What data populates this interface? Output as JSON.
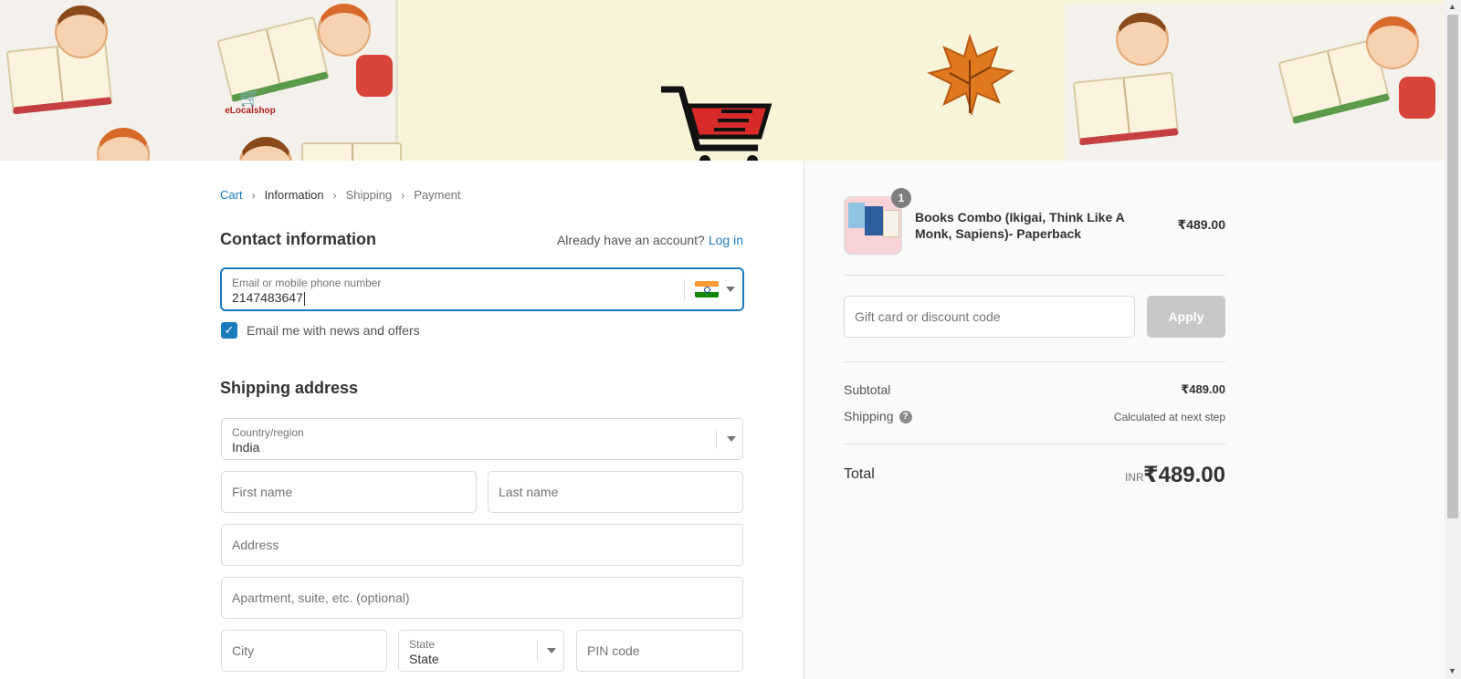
{
  "banner": {
    "logo_text": "eLocalshop"
  },
  "breadcrumb": {
    "items": [
      {
        "label": "Cart"
      },
      {
        "label": "Information"
      },
      {
        "label": "Shipping"
      },
      {
        "label": "Payment"
      }
    ]
  },
  "contact": {
    "title": "Contact information",
    "account_prompt": "Already have an account?",
    "login_label": "Log in",
    "email_label": "Email or mobile phone number",
    "email_value": "2147483647",
    "newsletter_label": "Email me with news and offers",
    "newsletter_checked": true
  },
  "shipping": {
    "title": "Shipping address",
    "country_label": "Country/region",
    "country_value": "India",
    "first_name_placeholder": "First name",
    "last_name_placeholder": "Last name",
    "address_placeholder": "Address",
    "apartment_placeholder": "Apartment, suite, etc. (optional)",
    "city_placeholder": "City",
    "state_label": "State",
    "state_value": "State",
    "pin_placeholder": "PIN code"
  },
  "summary": {
    "product_name": "Books Combo (Ikigai, Think Like A Monk, Sapiens)- Paperback",
    "product_price": "₹489.00",
    "quantity": "1",
    "discount_placeholder": "Gift card or discount code",
    "apply_label": "Apply",
    "subtotal_label": "Subtotal",
    "subtotal_value": "₹489.00",
    "shipping_label": "Shipping",
    "shipping_value": "Calculated at next step",
    "help_glyph": "?",
    "total_label": "Total",
    "total_currency": "INR",
    "total_value": "₹489.00"
  },
  "colors": {
    "link": "#197bbd",
    "checkbox": "#197bbd",
    "apply_disabled": "#c8c8c8",
    "summary_bg": "#fafafa"
  },
  "icons": {
    "breadcrumb_separator": "chevron-right-icon",
    "checkbox": "check-icon",
    "country_flag": "india-flag-icon",
    "select": "caret-down-icon",
    "help": "question-circle-icon"
  }
}
